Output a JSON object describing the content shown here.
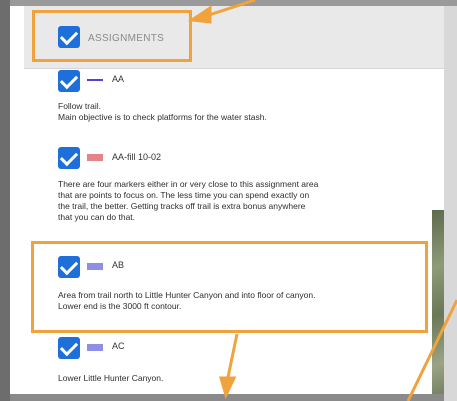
{
  "layer_panel": {
    "header_label": "ASSIGNMENTS",
    "items": [
      {
        "name": "AA",
        "swatch_color": "#5a3fd1",
        "swatch_style": "single",
        "description": [
          "Follow trail.",
          "Main objective is to check platforms for the water stash."
        ]
      },
      {
        "name": "AA-fill 10-02",
        "swatch_color": "#e3848c",
        "swatch_style": "double",
        "description": [
          "There are four markers either in or very close to this assignment area",
          "that are points to focus on. The less time you can spend exactly on",
          "the trail, the better. Getting tracks off trail is extra bonus anywhere",
          "that you can do that."
        ]
      },
      {
        "name": "AB",
        "swatch_color": "#8d8fe6",
        "swatch_style": "double",
        "description": [
          "Area from trail north to Little Hunter Canyon and into floor of canyon.",
          "Lower end is the 3000 ft contour."
        ]
      },
      {
        "name": "AC",
        "swatch_color": "#8d8fe6",
        "swatch_style": "double",
        "description": [
          "Lower Little Hunter Canyon."
        ]
      }
    ]
  },
  "colors": {
    "checkbox": "#1e6fd9",
    "highlight": "#f0a23c"
  }
}
